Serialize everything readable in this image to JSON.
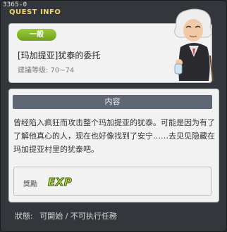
{
  "window": {
    "quest_id": "3365-0",
    "title": "QUEST INFO"
  },
  "header": {
    "category": "一般",
    "quest_name": "[玛加提亚]犹泰的委托",
    "level_requirement": "建議等级: 70~74"
  },
  "content": {
    "section_title": "内容",
    "description": "曾经陷入疯狂而攻击整个玛加提亚的犹泰。可能是因为有了了解他真心的人，现在也好像找到了安宁……去见见隐藏在玛加提亚村里的犹泰吧。"
  },
  "reward": {
    "label": "獎勵",
    "exp_icon_text": "EXP"
  },
  "status": {
    "label": "狀態:",
    "value": "可開始 / 不可执行任務"
  },
  "colors": {
    "title_accent": "#f3d66a",
    "badge_green": "#8bbd2e",
    "section_header": "#5d6874"
  },
  "icons": [
    "npc-portrait",
    "exp-icon"
  ]
}
